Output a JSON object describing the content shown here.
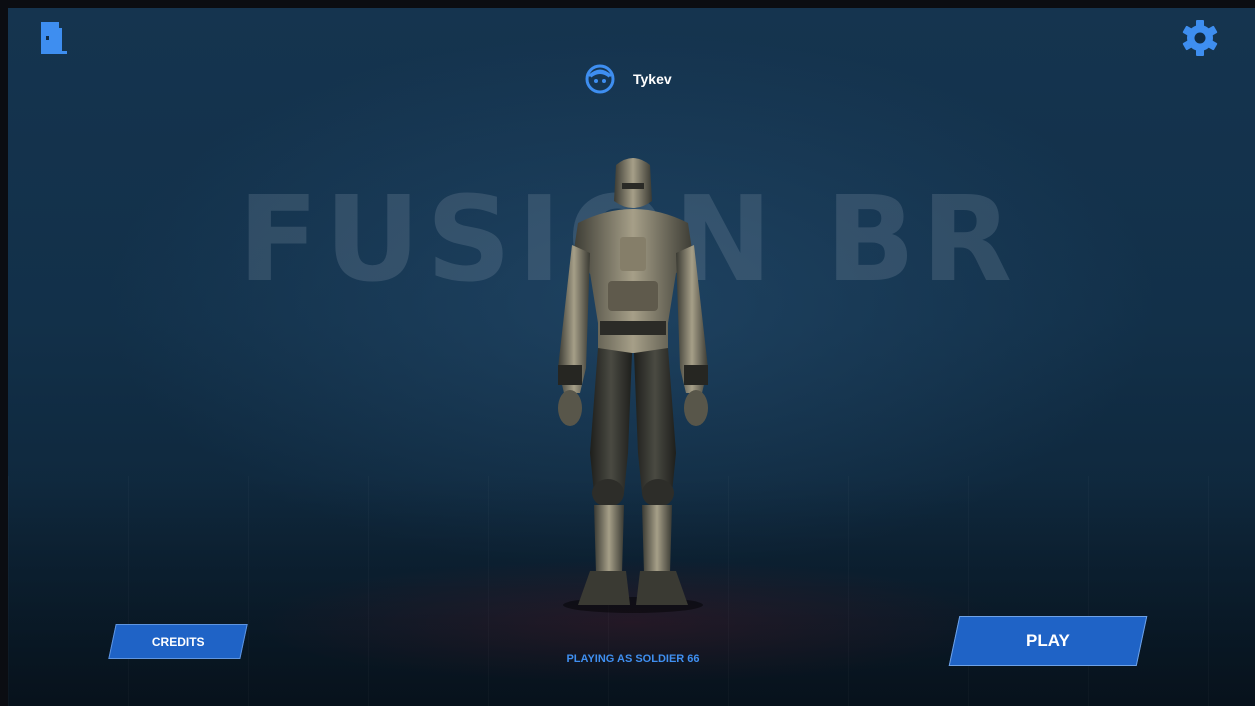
{
  "background_title": "FUSION BR",
  "profile": {
    "username": "Tykev",
    "icon": "face-icon"
  },
  "header": {
    "exit_icon": "exit-door-icon",
    "settings_icon": "gear-icon"
  },
  "buttons": {
    "credits_label": "CREDITS",
    "play_label": "PLAY"
  },
  "status": {
    "text": "PLAYING AS SOLDIER 66"
  },
  "colors": {
    "accent": "#1f63c6",
    "icon": "#3e8ef0",
    "status_text": "#3f8ff0"
  }
}
